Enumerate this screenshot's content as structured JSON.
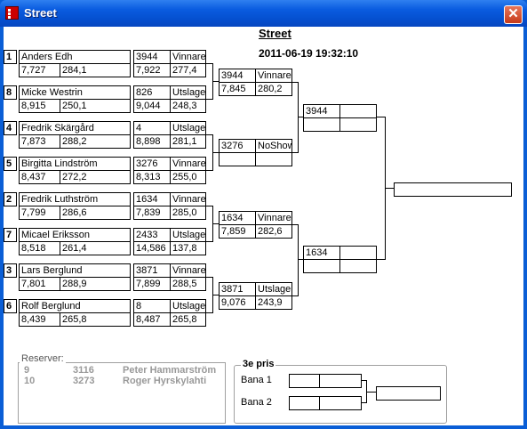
{
  "window": {
    "title": "Street",
    "close_label": "✕"
  },
  "header": {
    "title": "Street",
    "datetime": "2011-06-19 19:32:10"
  },
  "round1": [
    {
      "seed": "1",
      "name": "Anders Edh",
      "v1": "7,727",
      "v2": "284,1"
    },
    {
      "seed": "8",
      "name": "Micke Westrin",
      "v1": "8,915",
      "v2": "250,1"
    },
    {
      "seed": "4",
      "name": "Fredrik Skärgård",
      "v1": "7,873",
      "v2": "288,2"
    },
    {
      "seed": "5",
      "name": "Birgitta Lindström",
      "v1": "8,437",
      "v2": "272,2"
    },
    {
      "seed": "2",
      "name": "Fredrik Luthström",
      "v1": "7,799",
      "v2": "286,6"
    },
    {
      "seed": "7",
      "name": "Micael Eriksson",
      "v1": "8,518",
      "v2": "261,4"
    },
    {
      "seed": "3",
      "name": "Lars Berglund",
      "v1": "7,801",
      "v2": "288,9"
    },
    {
      "seed": "6",
      "name": "Rolf Berglund",
      "v1": "8,439",
      "v2": "265,8"
    }
  ],
  "round1_results": [
    {
      "id": "3944",
      "result": "Vinnare",
      "v1": "7,922",
      "v2": "277,4"
    },
    {
      "id": "826",
      "result": "Utslagen",
      "v1": "9,044",
      "v2": "248,3"
    },
    {
      "id": "4",
      "result": "Utslagen",
      "v1": "8,898",
      "v2": "281,1"
    },
    {
      "id": "3276",
      "result": "Vinnare",
      "v1": "8,313",
      "v2": "255,0"
    },
    {
      "id": "1634",
      "result": "Vinnare",
      "v1": "7,839",
      "v2": "285,0"
    },
    {
      "id": "2433",
      "result": "Utslagen",
      "v1": "14,586",
      "v2": "137,8"
    },
    {
      "id": "3871",
      "result": "Vinnare",
      "v1": "7,899",
      "v2": "288,5"
    },
    {
      "id": "8",
      "result": "Utslagen",
      "v1": "8,487",
      "v2": "265,8"
    }
  ],
  "quarter": [
    {
      "id": "3944",
      "result": "Vinnare",
      "v1": "7,845",
      "v2": "280,2"
    },
    {
      "id": "3276",
      "result": "NoShow",
      "v1": "",
      "v2": ""
    },
    {
      "id": "1634",
      "result": "Vinnare",
      "v1": "7,859",
      "v2": "282,6"
    },
    {
      "id": "3871",
      "result": "Utslagen",
      "v1": "9,076",
      "v2": "243,9"
    }
  ],
  "semi": [
    {
      "id": "3944",
      "result": "",
      "v1": "",
      "v2": ""
    },
    {
      "id": "1634",
      "result": "",
      "v1": "",
      "v2": ""
    }
  ],
  "final": {
    "value": ""
  },
  "reserves": {
    "label": "Reserver:",
    "rows": [
      {
        "num": "9",
        "id": "3116",
        "name": "Peter Hammarström"
      },
      {
        "num": "10",
        "id": "3273",
        "name": "Roger Hyrskylahti"
      }
    ]
  },
  "third_place": {
    "label": "3e pris",
    "bana1": "Bana 1",
    "bana2": "Bana 2"
  }
}
